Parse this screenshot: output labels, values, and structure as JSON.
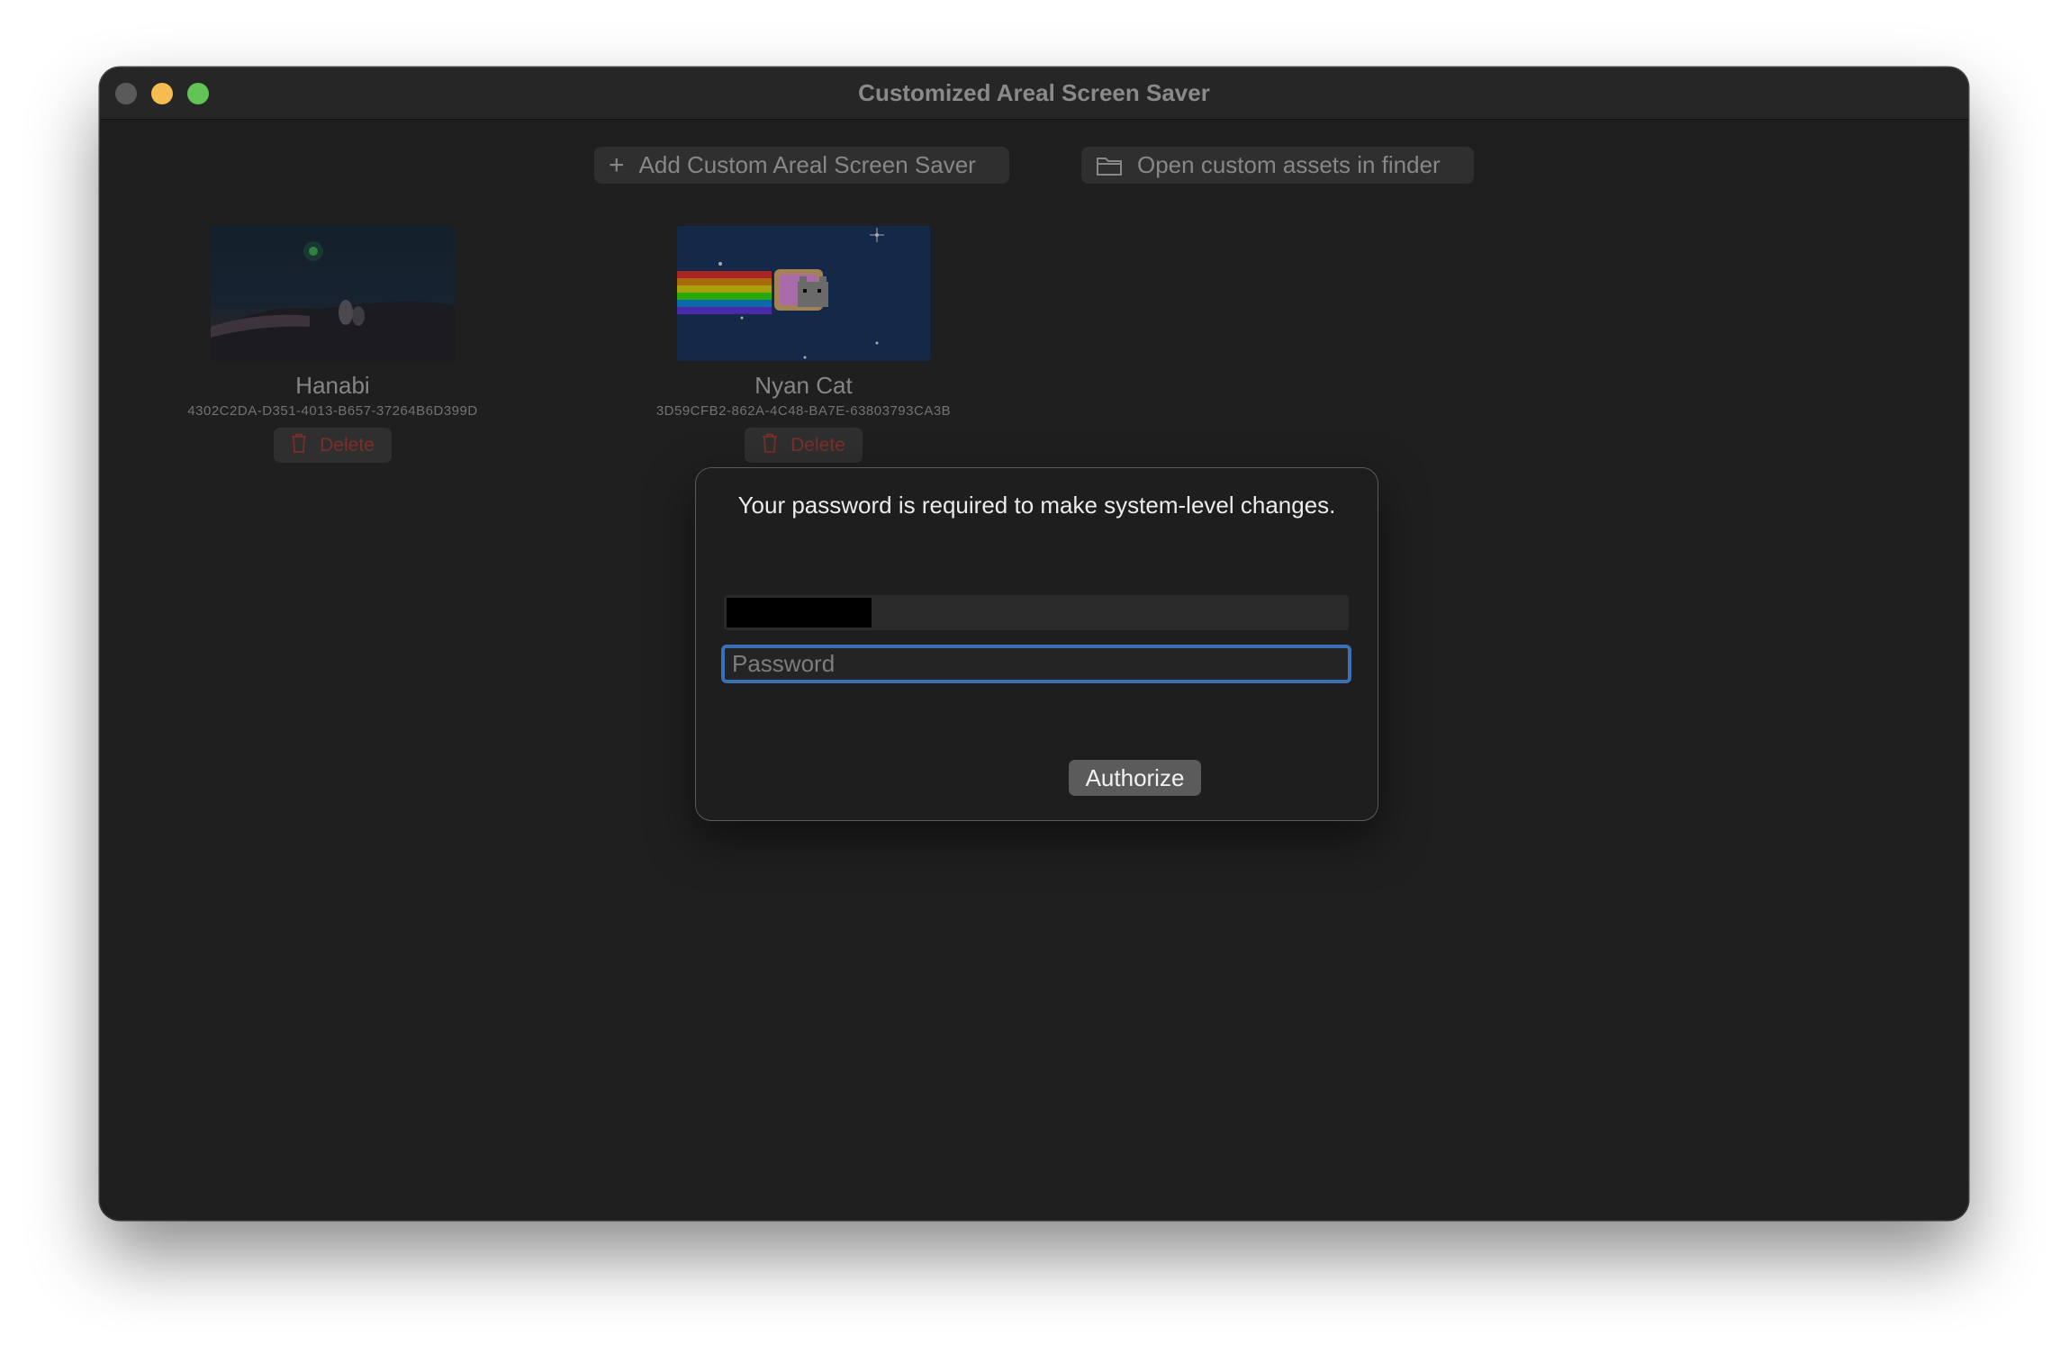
{
  "window": {
    "title": "Customized Areal Screen Saver"
  },
  "toolbar": {
    "add_label": "Add Custom Areal Screen Saver",
    "open_label": "Open custom assets in finder"
  },
  "screensavers": [
    {
      "name": "Hanabi",
      "id": "4302C2DA-D351-4013-B657-37264B6D399D",
      "delete_label": "Delete"
    },
    {
      "name": "Nyan Cat",
      "id": "3D59CFB2-862A-4C48-BA7E-63803793CA3B",
      "delete_label": "Delete"
    }
  ],
  "dialog": {
    "message": "Your password is required to make system-level changes.",
    "password_placeholder": "Password",
    "password_value": "",
    "authorize_label": "Authorize"
  },
  "colors": {
    "accent": "#3a71b4",
    "delete": "#b53a33",
    "window_bg": "#1f1f1f"
  }
}
